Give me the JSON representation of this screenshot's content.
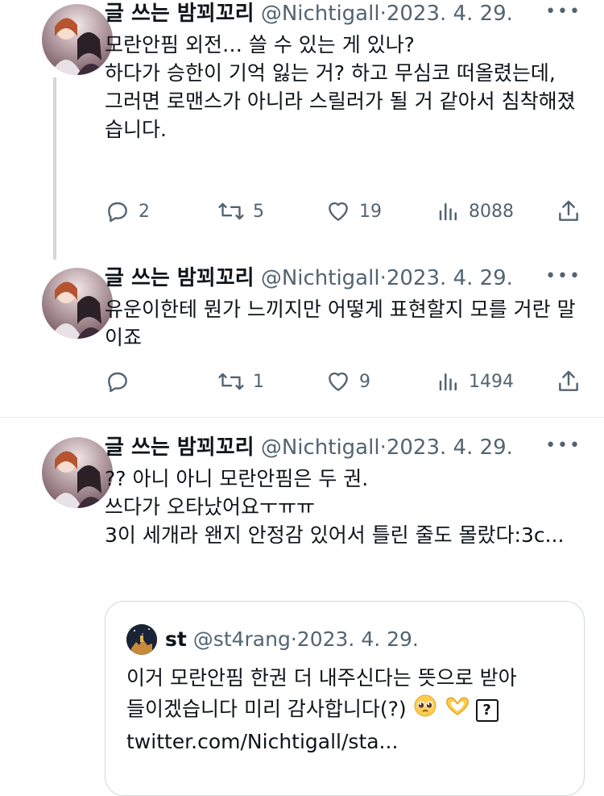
{
  "tweets": [
    {
      "author_name": "글 쓰는 밤꾀꼬리",
      "handle": "@Nichtigall",
      "separator": "·",
      "date": "2023. 4. 29.",
      "text": "모란안핌 외전… 쓸 수 있는 게 있나?\n하다가 승한이 기억 잃는 거? 하고 무심코 떠올렸는데,\n그러면 로맨스가 아니라 스릴러가 될 거 같아서 침착해졌습니다.",
      "replies": "2",
      "retweets": "5",
      "likes": "19",
      "views": "8088"
    },
    {
      "author_name": "글 쓰는 밤꾀꼬리",
      "handle": "@Nichtigall",
      "separator": "·",
      "date": "2023. 4. 29.",
      "text": "유운이한테 뭔가 느끼지만 어떻게 표현할지 모를 거란 말이죠",
      "replies": "",
      "retweets": "1",
      "likes": "9",
      "views": "1494"
    },
    {
      "author_name": "글 쓰는 밤꾀꼬리",
      "handle": "@Nichtigall",
      "separator": "·",
      "date": "2023. 4. 29.",
      "text": "?? 아니 아니 모란안핌은 두 권.\n쓰다가 오타났어요ㅜㅠㅠ\n3이 세개라 왠지 안정감 있어서 틀린 줄도 몰랐다:3c...",
      "quote": {
        "author_name": "st",
        "handle": "@st4rang",
        "separator": "·",
        "date": "2023. 4. 29.",
        "text_line1": "이거 모란안핌 한권 더 내주신다는 뜻으로 받아",
        "text_line2": "들이겠습니다 미리 감사합니다(?)",
        "unknown_glyph": "?",
        "link": "twitter.com/Nichtigall/sta..."
      }
    }
  ],
  "more_label": "•••",
  "icons": {
    "reply": "reply-icon",
    "retweet": "retweet-icon",
    "like": "heart-icon",
    "views": "views-icon",
    "share": "share-icon",
    "more": "more-icon"
  },
  "colors": {
    "text": "#0f1419",
    "secondary": "#536471",
    "border": "#cfd9de"
  }
}
